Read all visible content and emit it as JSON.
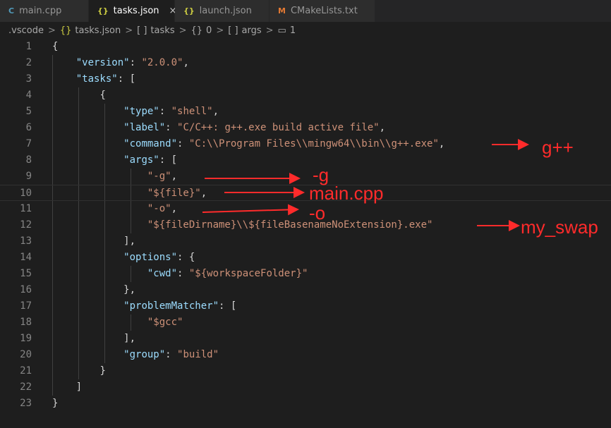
{
  "tabs": [
    {
      "label": "main.cpp",
      "icon": "C",
      "active": false
    },
    {
      "label": "tasks.json",
      "icon": "{}",
      "active": true,
      "close": "×"
    },
    {
      "label": "launch.json",
      "icon": "{}",
      "active": false
    },
    {
      "label": "CMakeLists.txt",
      "icon": "M",
      "active": false
    }
  ],
  "breadcrumb": {
    "items": [
      ".vscode",
      "tasks.json",
      "tasks",
      "0",
      "args",
      "1"
    ],
    "icons": [
      "",
      "{}",
      "[ ]",
      "{}",
      "[ ]",
      "▭"
    ],
    "separator": ">"
  },
  "editor": {
    "line_numbers": [
      "1",
      "2",
      "3",
      "4",
      "5",
      "6",
      "7",
      "8",
      "9",
      "10",
      "11",
      "12",
      "13",
      "14",
      "15",
      "16",
      "17",
      "18",
      "19",
      "20",
      "21",
      "22",
      "23"
    ],
    "lines": [
      {
        "indent": "",
        "parts": [
          [
            "p",
            "{"
          ]
        ]
      },
      {
        "indent": "    ",
        "parts": [
          [
            "k",
            "\"version\""
          ],
          [
            "p",
            ": "
          ],
          [
            "s",
            "\"2.0.0\""
          ],
          [
            "p",
            ","
          ]
        ]
      },
      {
        "indent": "    ",
        "parts": [
          [
            "k",
            "\"tasks\""
          ],
          [
            "p",
            ": ["
          ]
        ]
      },
      {
        "indent": "        ",
        "parts": [
          [
            "p",
            "{"
          ]
        ]
      },
      {
        "indent": "            ",
        "parts": [
          [
            "k",
            "\"type\""
          ],
          [
            "p",
            ": "
          ],
          [
            "s",
            "\"shell\""
          ],
          [
            "p",
            ","
          ]
        ]
      },
      {
        "indent": "            ",
        "parts": [
          [
            "k",
            "\"label\""
          ],
          [
            "p",
            ": "
          ],
          [
            "s",
            "\"C/C++: g++.exe build active file\""
          ],
          [
            "p",
            ","
          ]
        ]
      },
      {
        "indent": "            ",
        "parts": [
          [
            "k",
            "\"command\""
          ],
          [
            "p",
            ": "
          ],
          [
            "s",
            "\"C:\\\\Program Files\\\\mingw64\\\\bin\\\\g++.exe\""
          ],
          [
            "p",
            ","
          ]
        ]
      },
      {
        "indent": "            ",
        "parts": [
          [
            "k",
            "\"args\""
          ],
          [
            "p",
            ": ["
          ]
        ]
      },
      {
        "indent": "                ",
        "parts": [
          [
            "s",
            "\"-g\""
          ],
          [
            "p",
            ","
          ]
        ]
      },
      {
        "indent": "                ",
        "parts": [
          [
            "s",
            "\"${file}\""
          ],
          [
            "p",
            ","
          ]
        ]
      },
      {
        "indent": "                ",
        "parts": [
          [
            "s",
            "\"-o\""
          ],
          [
            "p",
            ","
          ]
        ]
      },
      {
        "indent": "                ",
        "parts": [
          [
            "s",
            "\"${fileDirname}\\\\${fileBasenameNoExtension}.exe\""
          ]
        ]
      },
      {
        "indent": "            ",
        "parts": [
          [
            "p",
            "],"
          ]
        ]
      },
      {
        "indent": "            ",
        "parts": [
          [
            "k",
            "\"options\""
          ],
          [
            "p",
            ": {"
          ]
        ]
      },
      {
        "indent": "                ",
        "parts": [
          [
            "k",
            "\"cwd\""
          ],
          [
            "p",
            ": "
          ],
          [
            "s",
            "\"${workspaceFolder}\""
          ]
        ]
      },
      {
        "indent": "            ",
        "parts": [
          [
            "p",
            "},"
          ]
        ]
      },
      {
        "indent": "            ",
        "parts": [
          [
            "k",
            "\"problemMatcher\""
          ],
          [
            "p",
            ": ["
          ]
        ]
      },
      {
        "indent": "                ",
        "parts": [
          [
            "s",
            "\"$gcc\""
          ]
        ]
      },
      {
        "indent": "            ",
        "parts": [
          [
            "p",
            "],"
          ]
        ]
      },
      {
        "indent": "            ",
        "parts": [
          [
            "k",
            "\"group\""
          ],
          [
            "p",
            ": "
          ],
          [
            "s",
            "\"build\""
          ]
        ]
      },
      {
        "indent": "        ",
        "parts": [
          [
            "p",
            "}"
          ]
        ]
      },
      {
        "indent": "    ",
        "parts": [
          [
            "p",
            "]"
          ]
        ]
      },
      {
        "indent": "",
        "parts": [
          [
            "p",
            "}"
          ]
        ]
      }
    ]
  },
  "annotations": [
    {
      "text": "g++",
      "line": 7
    },
    {
      "text": "-g",
      "line": 9
    },
    {
      "text": "main.cpp",
      "line": 10
    },
    {
      "text": "-o",
      "line": 11
    },
    {
      "text": "my_swap",
      "line": 12
    }
  ],
  "colors": {
    "key": "#9cdcfe",
    "string": "#ce9178",
    "annotation": "#ff2b2b",
    "background": "#1e1e1e"
  }
}
